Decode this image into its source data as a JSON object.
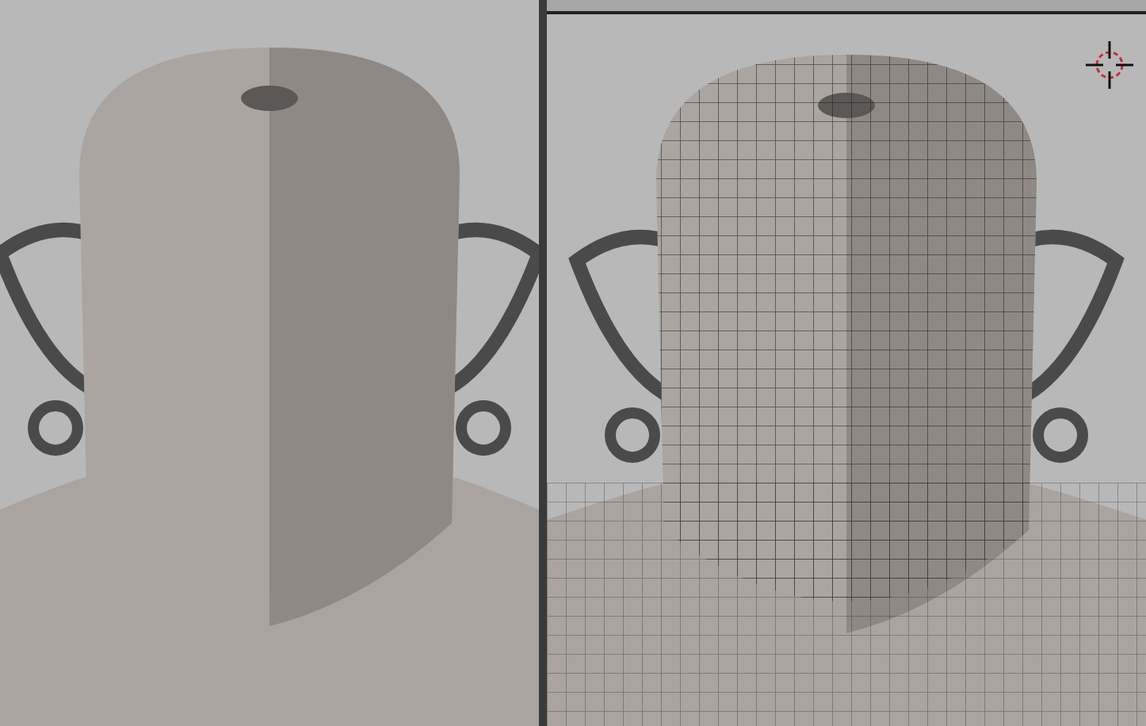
{
  "window": {
    "menu_bar": true
  },
  "viewports": [
    {
      "kind": "picture",
      "wireframe": false
    },
    {
      "kind": "picture",
      "wireframe": true,
      "cursor": true
    }
  ]
}
